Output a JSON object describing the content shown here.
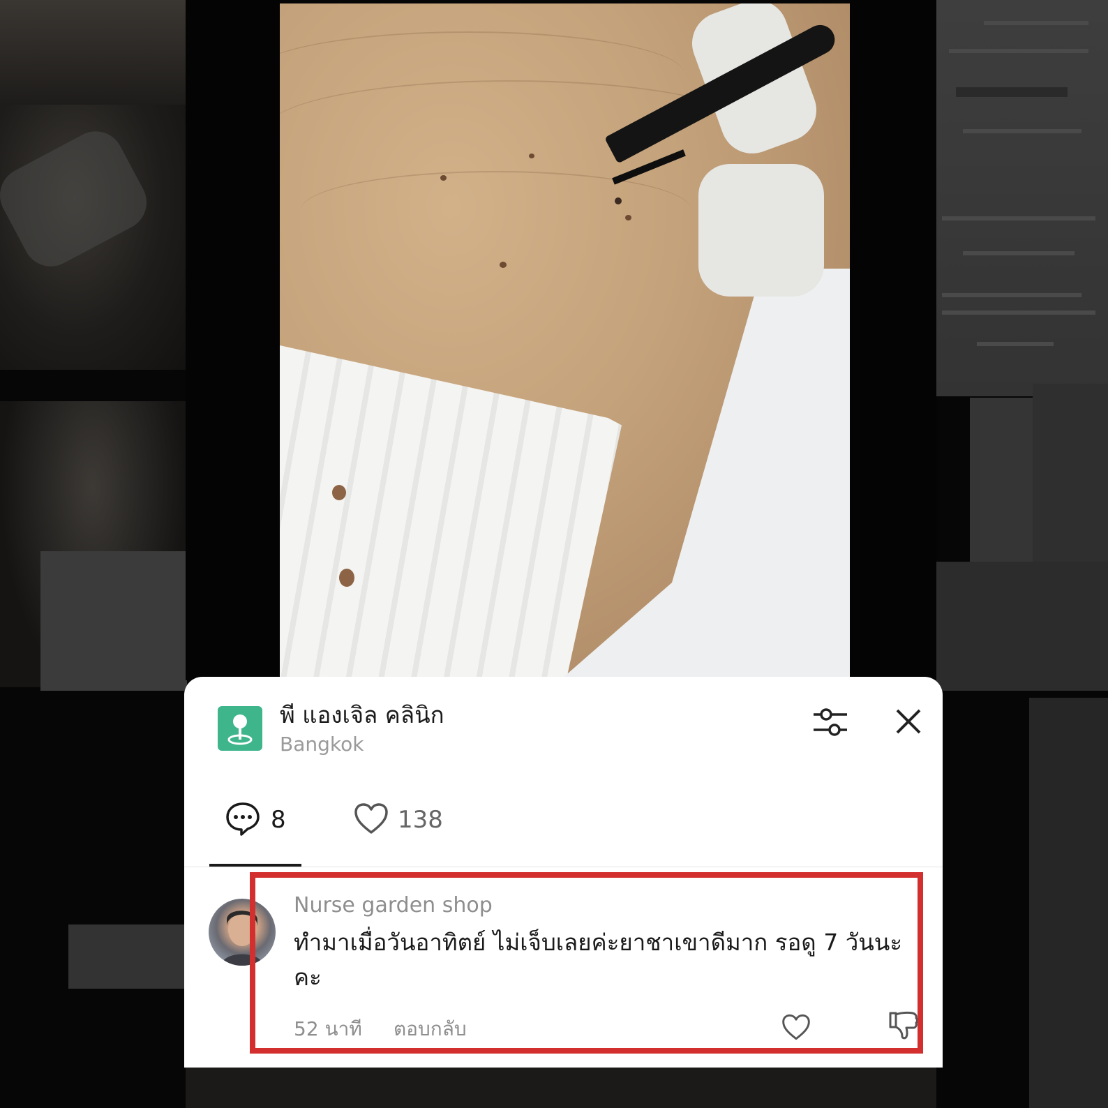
{
  "place": {
    "name": "พี แองเจิล คลินิก",
    "location": "Bangkok"
  },
  "tabs": {
    "comments_count": "8",
    "likes_count": "138"
  },
  "comment": {
    "author": "Nurse garden shop",
    "text": "ทำมาเมื่อวันอาทิตย์ ไม่เจ็บเลยค่ะยาชาเขาดีมาก รอดู 7 วันนะคะ",
    "time": "52 นาที",
    "reply_label": "ตอบกลับ"
  },
  "colors": {
    "highlight": "#d32f2f",
    "place_icon": "#3fb58c"
  },
  "icons": [
    "place-pin-icon",
    "filter-icon",
    "close-icon",
    "comment-bubble-icon",
    "heart-icon",
    "thumbs-down-icon"
  ]
}
